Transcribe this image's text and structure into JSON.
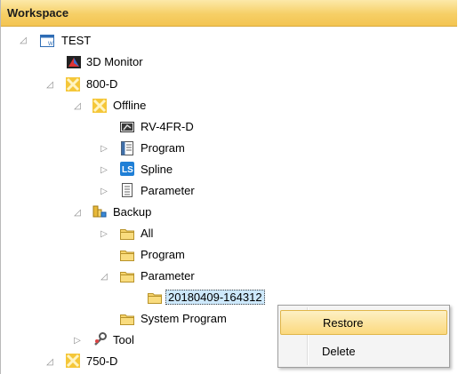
{
  "header": {
    "title": "Workspace"
  },
  "tree": [
    {
      "key": "test",
      "label": "TEST",
      "icon": "workspace-icon",
      "toggle": "◿"
    },
    {
      "key": "monitor",
      "label": "3D Monitor",
      "icon": "monitor-3d-icon",
      "toggle": ""
    },
    {
      "key": "robot800",
      "label": "800-D",
      "icon": "robot-controller-icon",
      "toggle": "◿"
    },
    {
      "key": "offline",
      "label": "Offline",
      "icon": "robot-controller-icon",
      "toggle": "◿"
    },
    {
      "key": "rv4fr",
      "label": "RV-4FR-D",
      "icon": "robot-model-icon",
      "toggle": ""
    },
    {
      "key": "program",
      "label": "Program",
      "icon": "program-icon",
      "toggle": "▷"
    },
    {
      "key": "spline",
      "label": "Spline",
      "icon": "spline-icon",
      "toggle": "▷"
    },
    {
      "key": "parameter",
      "label": "Parameter",
      "icon": "parameter-icon",
      "toggle": "▷"
    },
    {
      "key": "backup",
      "label": "Backup",
      "icon": "backup-icon",
      "toggle": "◿"
    },
    {
      "key": "all",
      "label": "All",
      "icon": "folder-icon",
      "toggle": "▷"
    },
    {
      "key": "bprogram",
      "label": "Program",
      "icon": "folder-icon",
      "toggle": ""
    },
    {
      "key": "bparameter",
      "label": "Parameter",
      "icon": "folder-icon",
      "toggle": "◿"
    },
    {
      "key": "snapshot",
      "label": "20180409-164312",
      "icon": "folder-icon",
      "toggle": ""
    },
    {
      "key": "sysprog",
      "label": "System Program",
      "icon": "folder-icon",
      "toggle": ""
    },
    {
      "key": "tool",
      "label": "Tool",
      "icon": "tool-icon",
      "toggle": "▷"
    },
    {
      "key": "robot750",
      "label": "750-D",
      "icon": "robot-controller-icon",
      "toggle": "◿"
    }
  ],
  "context_menu": {
    "items": [
      "Restore",
      "Delete"
    ],
    "highlighted": "Restore"
  },
  "colors": {
    "header": "#f6cf66",
    "selection": "#cde8fb",
    "menu_hover": "#fbd97e"
  }
}
